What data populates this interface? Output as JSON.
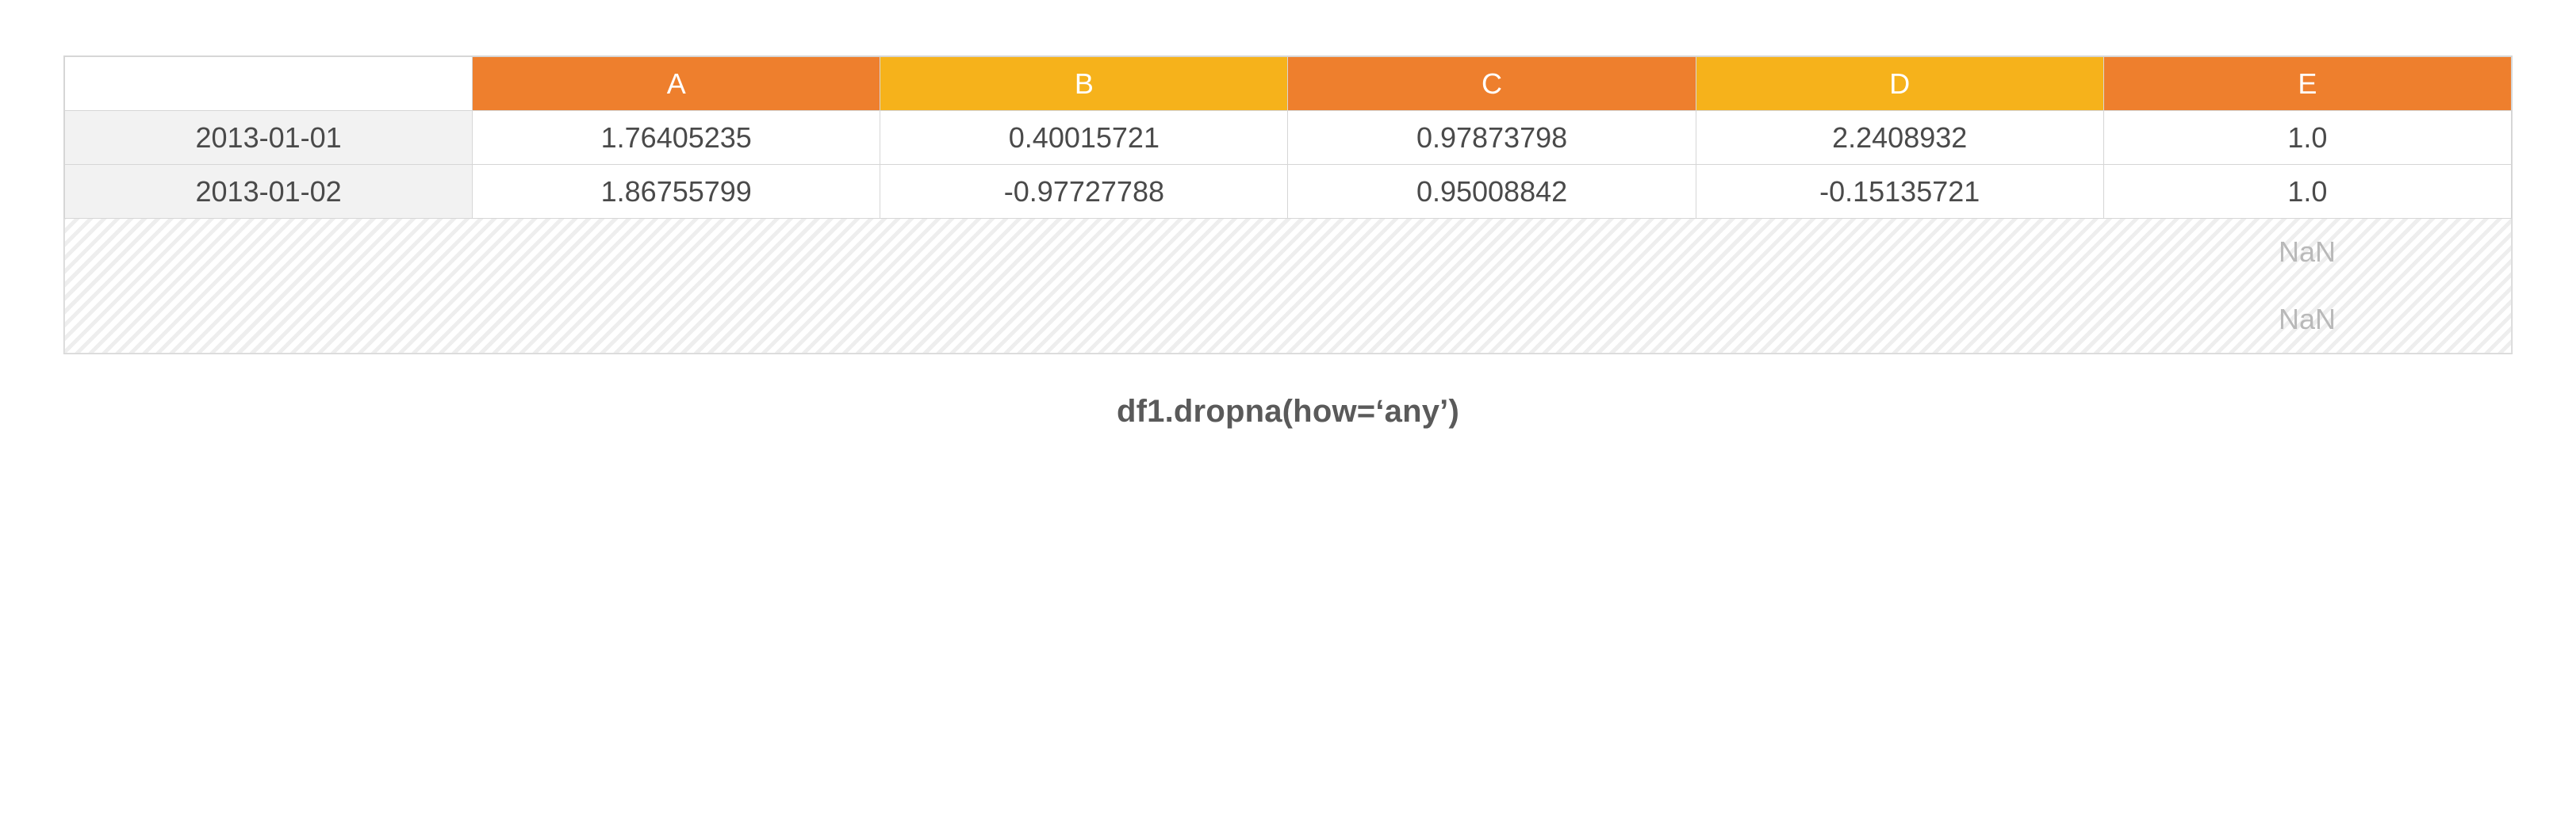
{
  "columns": {
    "A": "A",
    "B": "B",
    "C": "C",
    "D": "D",
    "E": "E"
  },
  "rows": [
    {
      "index": "2013-01-01",
      "A": "1.76405235",
      "B": "0.40015721",
      "C": "0.97873798",
      "D": "2.2408932",
      "E": "1.0"
    },
    {
      "index": "2013-01-02",
      "A": "1.86755799",
      "B": "-0.97727788",
      "C": "0.95008842",
      "D": "-0.15135721",
      "E": "1.0"
    }
  ],
  "dropped": {
    "nan1": "NaN",
    "nan2": "NaN"
  },
  "caption": "df1.dropna(how=‘any’)"
}
